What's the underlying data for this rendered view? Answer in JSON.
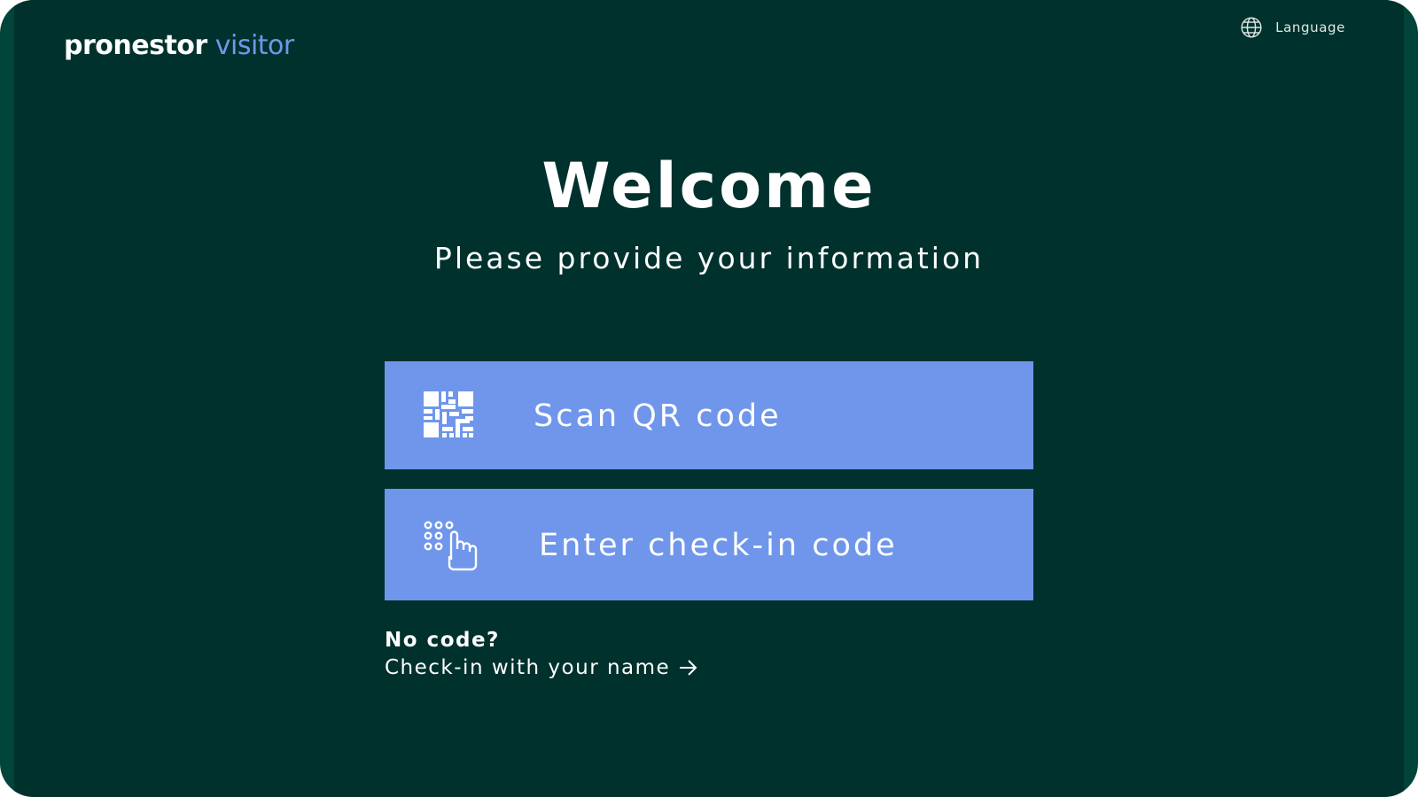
{
  "header": {
    "logo": {
      "brand": "pronestor",
      "product": "visitor"
    },
    "language_label": "Language"
  },
  "main": {
    "title": "Welcome",
    "subtitle": "Please provide your information",
    "options": {
      "scan_qr": {
        "label": "Scan QR code",
        "icon": "qr-code-icon"
      },
      "enter_code": {
        "label": "Enter check-in code",
        "icon": "keypad-touch-icon"
      }
    },
    "no_code": {
      "title": "No code?",
      "link_label": "Check-in with your name",
      "link_icon": "arrow-right-icon"
    }
  },
  "colors": {
    "background": "#00312d",
    "frame": "#00443a",
    "accent": "#6f96ea",
    "text": "#ffffff"
  }
}
